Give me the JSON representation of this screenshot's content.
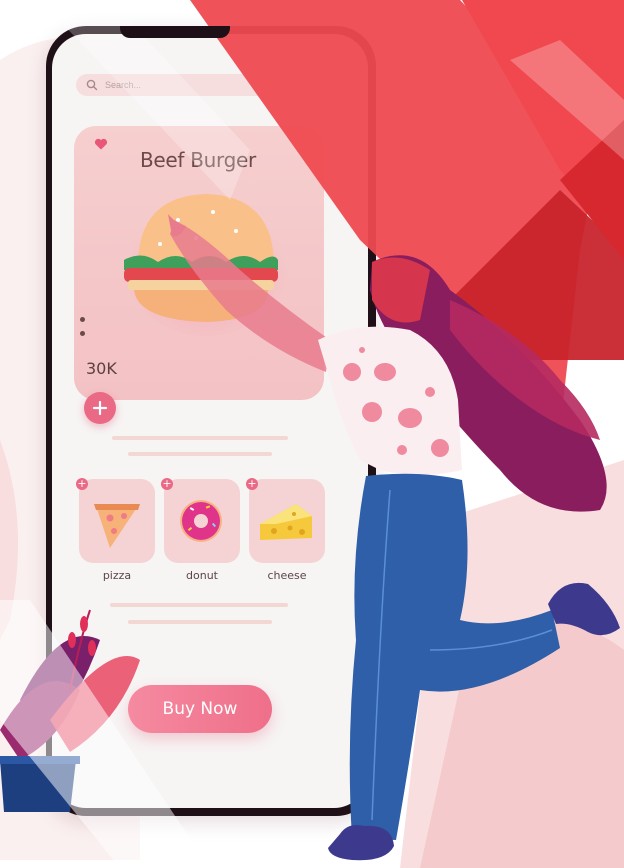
{
  "search": {
    "placeholder": "Search..."
  },
  "product": {
    "title": "Beef Burger",
    "price": "30K"
  },
  "categories": [
    {
      "label": "pizza",
      "icon": "pizza-slice-icon"
    },
    {
      "label": "donut",
      "icon": "donut-icon"
    },
    {
      "label": "cheese",
      "icon": "cheese-icon"
    }
  ],
  "cta": {
    "label": "Buy Now"
  },
  "colors": {
    "accent": "#ea6a86",
    "card": "#f6cfcf",
    "ribbon": "#ee4a50",
    "jeans": "#2e5fa8"
  }
}
